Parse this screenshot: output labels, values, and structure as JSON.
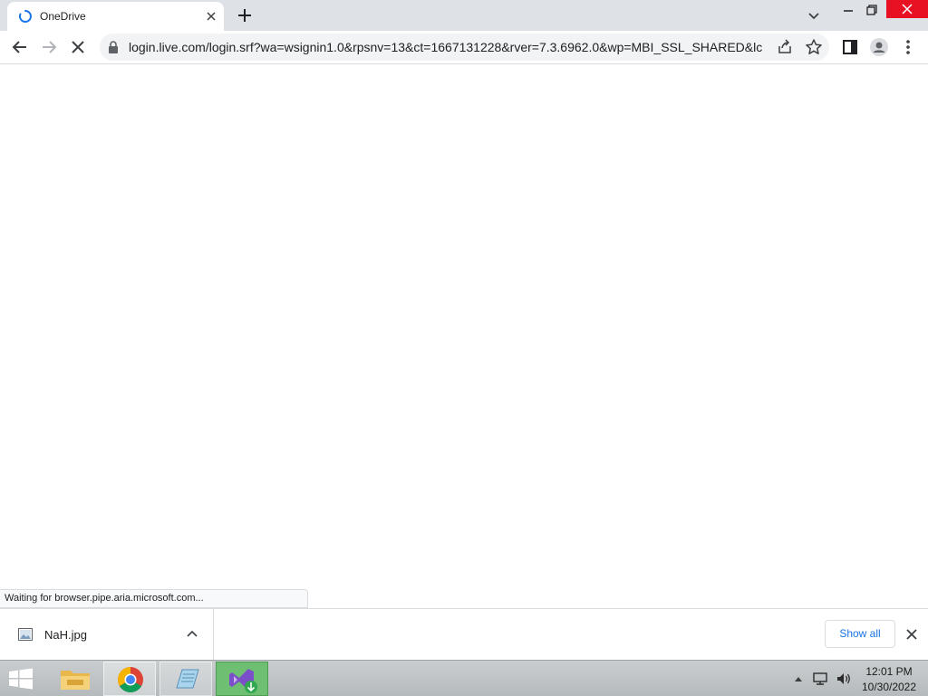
{
  "browser": {
    "tab": {
      "title": "OneDrive",
      "loading": true
    },
    "address_bar": {
      "url": "login.live.com/login.srf?wa=wsignin1.0&rpsnv=13&ct=1667131228&rver=7.3.6962.0&wp=MBI_SSL_SHARED&lc..."
    },
    "status_text": "Waiting for browser.pipe.aria.microsoft.com..."
  },
  "download_shelf": {
    "items": [
      {
        "filename": "NaH.jpg"
      }
    ],
    "show_all_label": "Show all"
  },
  "taskbar": {
    "apps": [
      "file-explorer",
      "chrome",
      "notepad",
      "visual-studio-installer"
    ],
    "clock": {
      "time": "12:01 PM",
      "date": "10/30/2022"
    }
  },
  "colors": {
    "tab_strip": "#dee1e6",
    "accent_blue": "#1a73e8",
    "close_red": "#e81123",
    "taskbar": "#c9cdcf"
  }
}
